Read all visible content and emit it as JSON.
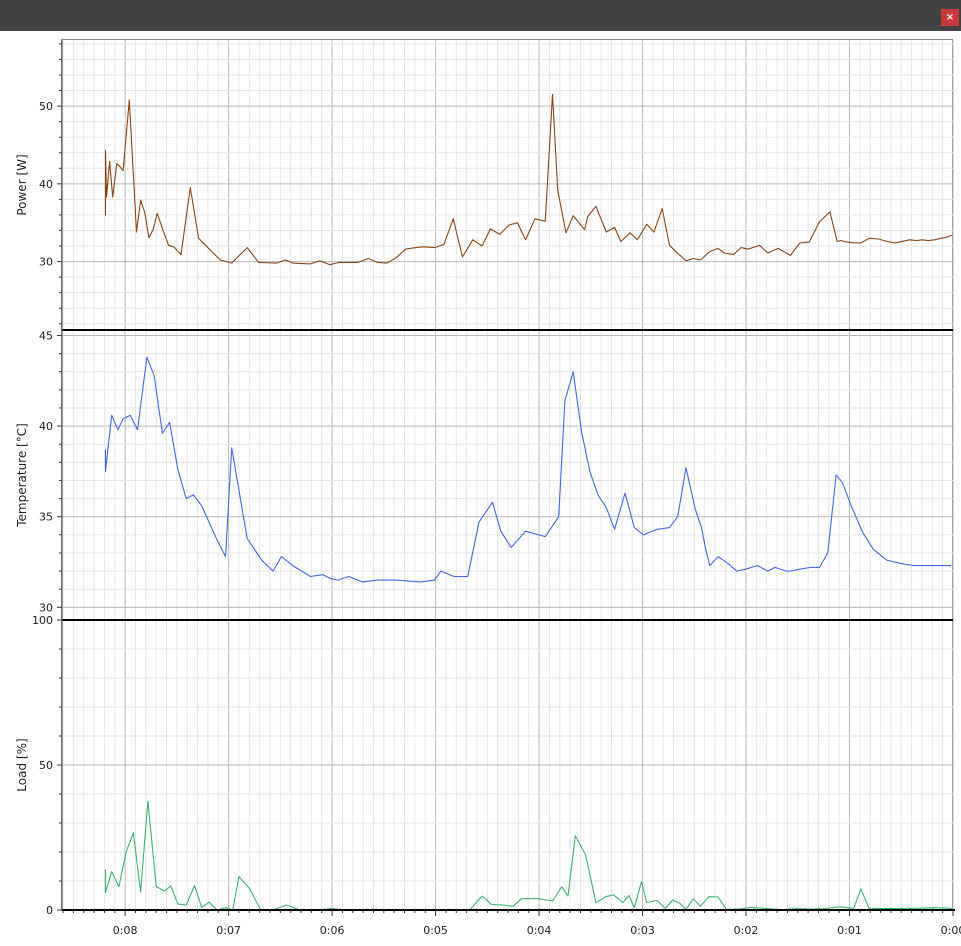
{
  "window": {
    "close_label": "×"
  },
  "colors": {
    "titlebar": "#434343",
    "close_button": "#c9393b",
    "power_line": "#8b4513",
    "temperature_line": "#4169e1",
    "load_line": "#3cb371",
    "grid_major": "#b8b8b8",
    "grid_minor": "#e6e6e6",
    "separator": "#000000"
  },
  "chart_data": [
    {
      "type": "line",
      "id": "power",
      "ylabel": "Power [W]",
      "ylim": [
        21.2,
        58.5
      ],
      "yticks": [
        30,
        40,
        50
      ],
      "xlim": [
        8.61,
        0
      ],
      "grid": true,
      "series": [
        {
          "x": [
            8.19,
            8.19,
            8.18,
            8.15,
            8.12,
            8.08,
            8.05,
            8.02,
            7.96,
            7.89,
            7.85,
            7.81,
            7.77,
            7.73,
            7.69,
            7.63,
            7.58,
            7.53,
            7.46,
            7.37,
            7.29,
            7.08,
            7.02,
            6.97,
            6.82,
            6.71,
            6.54,
            6.45,
            6.38,
            6.21,
            6.12,
            6.02,
            5.93,
            5.75,
            5.65,
            5.56,
            5.47,
            5.38,
            5.29,
            5.19,
            5.12,
            5.01,
            4.92,
            4.83,
            4.74,
            4.64,
            4.55,
            4.47,
            4.38,
            4.29,
            4.21,
            4.13,
            4.04,
            3.94,
            3.87,
            3.82,
            3.74,
            3.67,
            3.56,
            3.53,
            3.45,
            3.35,
            3.27,
            3.21,
            3.12,
            3.05,
            2.96,
            2.89,
            2.81,
            2.74,
            2.67,
            2.58,
            2.51,
            2.44,
            2.35,
            2.27,
            2.21,
            2.12,
            2.05,
            1.98,
            1.87,
            1.79,
            1.69,
            1.57,
            1.48,
            1.39,
            1.29,
            1.19,
            1.12,
            1.08,
            1.02,
            0.96,
            0.89,
            0.81,
            0.72,
            0.64,
            0.56,
            0.42,
            0.35,
            0.3,
            0.24,
            0.18,
            0.12,
            0.07,
            0.01
          ],
          "y": [
            35.9,
            44.3,
            38.3,
            42.9,
            38.3,
            42.6,
            42.2,
            41.7,
            50.8,
            33.8,
            37.9,
            36.3,
            33.1,
            34.1,
            36.2,
            33.9,
            32.1,
            31.9,
            30.9,
            39.5,
            33.0,
            30.2,
            30.0,
            29.8,
            31.8,
            29.9,
            29.8,
            30.2,
            29.8,
            29.7,
            30.1,
            29.6,
            29.9,
            29.9,
            30.4,
            29.9,
            29.8,
            30.5,
            31.6,
            31.8,
            31.9,
            31.8,
            32.2,
            35.5,
            30.6,
            32.8,
            32.0,
            34.2,
            33.5,
            34.7,
            35.0,
            32.8,
            35.5,
            35.2,
            51.5,
            39.2,
            33.7,
            35.9,
            34.1,
            35.8,
            37.1,
            33.8,
            34.4,
            32.6,
            33.7,
            32.8,
            34.8,
            33.8,
            36.8,
            32.1,
            31.2,
            30.1,
            30.4,
            30.2,
            31.3,
            31.7,
            31.1,
            30.9,
            31.8,
            31.6,
            32.1,
            31.1,
            31.7,
            30.8,
            32.4,
            32.5,
            35.1,
            36.4,
            32.6,
            32.7,
            32.5,
            32.4,
            32.4,
            33.0,
            32.9,
            32.6,
            32.4,
            32.8,
            32.7,
            32.8,
            32.7,
            32.8,
            33.0,
            33.1,
            33.4
          ]
        }
      ]
    },
    {
      "type": "line",
      "id": "temperature",
      "ylabel": "Temperature [°C]",
      "ylim": [
        29.3,
        45.3
      ],
      "yticks": [
        30,
        35,
        40,
        45
      ],
      "xlim": [
        8.61,
        0
      ],
      "grid": true,
      "series": [
        {
          "x": [
            8.19,
            8.19,
            8.13,
            8.07,
            8.02,
            7.95,
            7.88,
            7.79,
            7.72,
            7.64,
            7.57,
            7.49,
            7.41,
            7.34,
            7.26,
            7.11,
            7.03,
            6.97,
            6.82,
            6.68,
            6.57,
            6.49,
            6.38,
            6.21,
            6.09,
            6.02,
            5.94,
            5.84,
            5.71,
            5.56,
            5.39,
            5.14,
            5.01,
            4.95,
            4.82,
            4.69,
            4.58,
            4.45,
            4.37,
            4.27,
            4.13,
            3.94,
            3.81,
            3.75,
            3.67,
            3.59,
            3.51,
            3.43,
            3.35,
            3.27,
            3.17,
            3.08,
            2.99,
            2.86,
            2.74,
            2.66,
            2.58,
            2.49,
            2.43,
            2.39,
            2.35,
            2.27,
            2.17,
            2.09,
            2.01,
            1.89,
            1.79,
            1.72,
            1.61,
            1.57,
            1.49,
            1.38,
            1.29,
            1.21,
            1.13,
            1.07,
            0.97,
            0.87,
            0.77,
            0.64,
            0.49,
            0.38,
            0.26,
            0.12,
            0.02
          ],
          "y": [
            38.7,
            37.5,
            40.6,
            39.8,
            40.4,
            40.6,
            39.8,
            43.8,
            42.8,
            39.6,
            40.2,
            37.6,
            36.0,
            36.2,
            35.6,
            33.7,
            32.8,
            38.8,
            33.8,
            32.6,
            32.0,
            32.8,
            32.3,
            31.7,
            31.8,
            31.6,
            31.5,
            31.7,
            31.4,
            31.5,
            31.5,
            31.4,
            31.5,
            32.0,
            31.7,
            31.7,
            34.7,
            35.8,
            34.2,
            33.3,
            34.2,
            33.9,
            35.0,
            41.4,
            43.0,
            39.7,
            37.5,
            36.2,
            35.5,
            34.3,
            36.3,
            34.4,
            34.0,
            34.3,
            34.4,
            35.0,
            37.7,
            35.4,
            34.4,
            33.2,
            32.3,
            32.8,
            32.4,
            32.0,
            32.1,
            32.3,
            32.0,
            32.2,
            32.0,
            32.0,
            32.1,
            32.2,
            32.2,
            33.0,
            37.3,
            36.9,
            35.4,
            34.1,
            33.2,
            32.6,
            32.4,
            32.3,
            32.3,
            32.3,
            32.3
          ]
        }
      ]
    },
    {
      "type": "line",
      "id": "load",
      "ylabel": "Load [%]",
      "ylim": [
        0,
        100
      ],
      "yticks": [
        0,
        50,
        100
      ],
      "xlim": [
        8.61,
        0
      ],
      "grid": true,
      "series": [
        {
          "x": [
            8.19,
            8.19,
            8.13,
            8.06,
            7.99,
            7.92,
            7.85,
            7.78,
            7.7,
            7.62,
            7.56,
            7.49,
            7.41,
            7.33,
            7.26,
            7.19,
            7.11,
            7.03,
            6.96,
            6.9,
            6.8,
            6.69,
            6.57,
            6.44,
            6.31,
            6.16,
            6.01,
            5.85,
            5.68,
            5.52,
            5.36,
            5.21,
            5.01,
            4.8,
            4.67,
            4.55,
            4.46,
            4.35,
            4.25,
            4.17,
            4.02,
            3.87,
            3.78,
            3.72,
            3.65,
            3.55,
            3.45,
            3.35,
            3.28,
            3.19,
            3.13,
            3.08,
            3.01,
            2.96,
            2.86,
            2.78,
            2.71,
            2.64,
            2.58,
            2.51,
            2.44,
            2.36,
            2.27,
            2.19,
            2.07,
            1.94,
            1.8,
            1.65,
            1.53,
            1.39,
            1.24,
            1.09,
            0.96,
            0.89,
            0.81,
            0.73,
            0.56,
            0.37,
            0.19,
            0.01
          ],
          "y": [
            14.0,
            6.0,
            13.2,
            8.0,
            20.1,
            26.6,
            6.2,
            37.6,
            8.1,
            6.5,
            8.3,
            2.1,
            1.7,
            8.4,
            0.9,
            2.7,
            0,
            0.8,
            0,
            11.5,
            7.5,
            0,
            0,
            1.7,
            0,
            0,
            0.5,
            0,
            0.2,
            0.2,
            0,
            0,
            0,
            0,
            0,
            4.8,
            1.9,
            1.7,
            1.3,
            3.9,
            4.0,
            3.1,
            8.0,
            4.8,
            25.6,
            19.0,
            2.5,
            4.7,
            5.2,
            2.6,
            5.0,
            0.8,
            9.8,
            2.6,
            3.3,
            0.5,
            3.4,
            2.3,
            0.2,
            3.9,
            1.3,
            4.6,
            4.5,
            0.2,
            0.3,
            0.9,
            0.5,
            0.1,
            0.5,
            0.3,
            0.5,
            1.1,
            0.6,
            7.3,
            0.4,
            0.5,
            0.5,
            0.6,
            0.8,
            0.6
          ]
        }
      ]
    }
  ],
  "x_axis": {
    "tick_labels": [
      "0:08",
      "0:07",
      "0:06",
      "0:05",
      "0:04",
      "0:03",
      "0:02",
      "0:01",
      "0:00"
    ],
    "tick_values": [
      8,
      7,
      6,
      5,
      4,
      3,
      2,
      1,
      0
    ]
  }
}
